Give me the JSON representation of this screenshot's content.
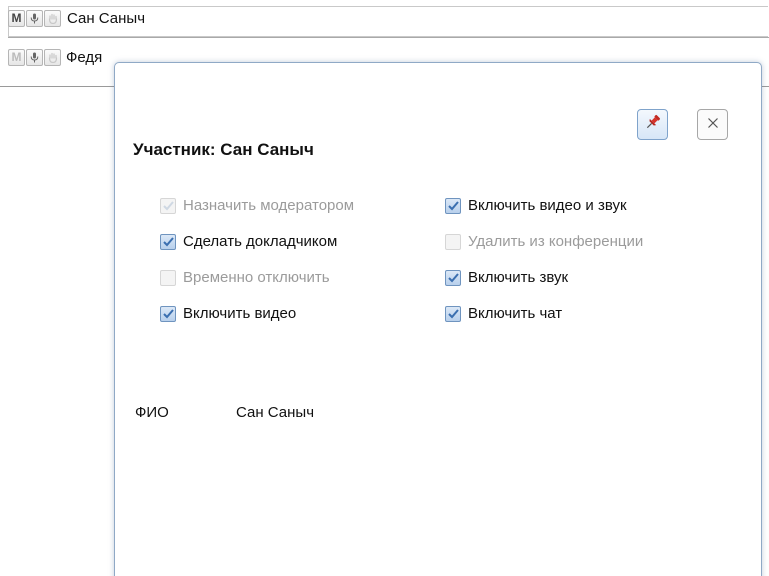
{
  "participants": [
    {
      "name": "Сан Саныч",
      "controls": [
        {
          "icon": "moderator-m-icon",
          "glyph": "M",
          "enabled": true
        },
        {
          "icon": "microphone-icon",
          "enabled": true
        },
        {
          "icon": "hand-icon",
          "enabled": false
        }
      ]
    },
    {
      "name": "Федя",
      "controls": [
        {
          "icon": "moderator-m-icon",
          "glyph": "M",
          "enabled": false
        },
        {
          "icon": "microphone-icon",
          "enabled": true
        },
        {
          "icon": "hand-icon",
          "enabled": false
        }
      ]
    }
  ],
  "dialog": {
    "title": "Участник: Сан Саныч",
    "pin_icon": "pin-icon",
    "close_icon": "close-icon",
    "options": [
      {
        "id": "make-moderator",
        "label": "Назначить модератором",
        "checked": true,
        "enabled": false
      },
      {
        "id": "enable-video-and-audio",
        "label": "Включить видео и звук",
        "checked": true,
        "enabled": true
      },
      {
        "id": "make-presenter",
        "label": "Сделать докладчиком",
        "checked": true,
        "enabled": true
      },
      {
        "id": "remove-from-conference",
        "label": "Удалить из конференции",
        "checked": false,
        "enabled": false
      },
      {
        "id": "temporarily-disable",
        "label": "Временно отключить",
        "checked": false,
        "enabled": false
      },
      {
        "id": "enable-audio",
        "label": "Включить звук",
        "checked": true,
        "enabled": true
      },
      {
        "id": "enable-video",
        "label": "Включить видео",
        "checked": true,
        "enabled": true
      },
      {
        "id": "enable-chat",
        "label": "Включить чат",
        "checked": true,
        "enabled": true
      }
    ],
    "info": {
      "label": "ФИО",
      "value": "Сан Саныч"
    }
  },
  "colors": {
    "dialog_border": "#8fa9c6",
    "checkbox_check": "#3b6fb0",
    "disabled_text": "#9b9b9b",
    "pin_red": "#d8332a"
  }
}
